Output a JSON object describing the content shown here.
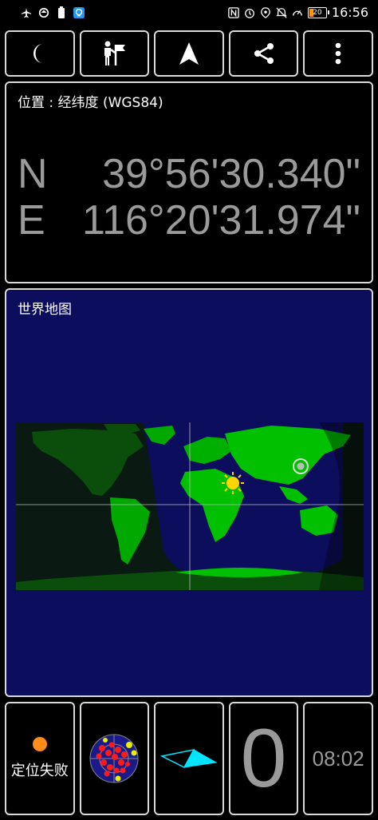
{
  "status_bar": {
    "time": "16:56",
    "battery": "20",
    "left_icons": [
      "airplane-icon",
      "sync-icon",
      "battery-saver-icon",
      "bulb-icon"
    ],
    "right_icons": [
      "nfc-icon",
      "alarm-icon",
      "location-icon",
      "mute-icon",
      "speed-icon"
    ]
  },
  "toolbar": {
    "buttons": [
      {
        "name": "night-mode-button",
        "icon": "moon-icon"
      },
      {
        "name": "waypoint-button",
        "icon": "person-flag-icon"
      },
      {
        "name": "navigate-button",
        "icon": "navigation-arrow-icon"
      },
      {
        "name": "share-button",
        "icon": "share-icon"
      },
      {
        "name": "more-button",
        "icon": "more-vertical-icon"
      }
    ]
  },
  "position": {
    "title": "位置 : 经纬度 (WGS84)",
    "lat_hemisphere": "N",
    "lat_value": "39°56'30.340\"",
    "lon_hemisphere": "E",
    "lon_value": "116°20'31.974\""
  },
  "map": {
    "title": "世界地图"
  },
  "bottom": {
    "fix_status": "定位失败",
    "satellite_count": "0",
    "time": "08:02"
  },
  "colors": {
    "panel_border": "#d9d9d9",
    "map_ocean": "#0d0d5e",
    "land_day": "#00c000",
    "fix_dot": "#ff8c1a",
    "value_gray": "#9a9a9a"
  }
}
